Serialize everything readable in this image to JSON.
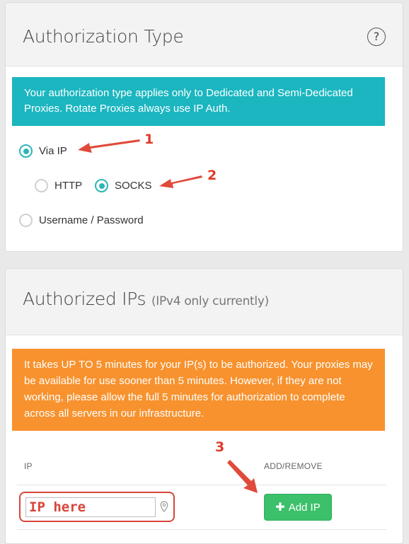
{
  "auth_card": {
    "title": "Authorization Type",
    "help_icon": "?",
    "notice": "Your authorization type applies only to Dedicated and Semi-Dedicated Proxies. Rotate Proxies always use IP Auth.",
    "options": {
      "via_ip": {
        "label": "Via IP",
        "selected": true
      },
      "http": {
        "label": "HTTP",
        "selected": false
      },
      "socks": {
        "label": "SOCKS",
        "selected": true
      },
      "username_password": {
        "label": "Username / Password",
        "selected": false
      }
    }
  },
  "ips_card": {
    "title": "Authorized IPs",
    "subtitle": "(IPv4 only currently)",
    "notice": "It takes UP TO 5 minutes for your IP(s) to be authorized. Your proxies may be available for use sooner than 5 minutes. However, if they are not working, please allow the full 5 minutes for authorization to complete across all servers in our infrastructure.",
    "columns": {
      "ip": "IP",
      "action": "ADD/REMOVE"
    },
    "ip_input_value": "IP here",
    "add_button_label": "Add IP",
    "icons": {
      "add": "plus-icon",
      "input_addon": "map-pin-icon"
    }
  },
  "annotations": {
    "one": "1",
    "two": "2",
    "three": "3",
    "color": "#e03a2a"
  }
}
